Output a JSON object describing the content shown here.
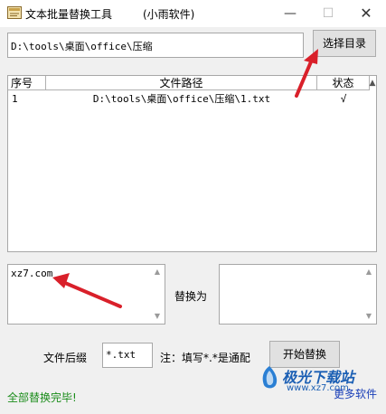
{
  "window": {
    "title": "文本批量替换工具",
    "subtitle": "(小雨软件)",
    "min_glyph": "—",
    "max_glyph": "☐",
    "close_glyph": "✕"
  },
  "folder": {
    "path_value": "D:\\tools\\桌面\\office\\压缩",
    "select_button": "选择目录"
  },
  "file_list": {
    "columns": [
      "序号",
      "文件路径",
      "状态"
    ],
    "sort_glyph": "▲",
    "rows": [
      {
        "seq": "1",
        "path": "D:\\tools\\桌面\\office\\压缩\\1.txt",
        "state": "√"
      }
    ]
  },
  "find": {
    "value": "xz7.com"
  },
  "replace": {
    "label": "替换为",
    "value": ""
  },
  "extension": {
    "label": "文件后缀",
    "value": "*.txt",
    "hint": "注：填写*.*是通配"
  },
  "actions": {
    "start_button": "开始替换"
  },
  "status": {
    "text": "全部替换完毕!"
  },
  "footer": {
    "more_link": "更多软件"
  },
  "watermark": {
    "brand": "极光下载站",
    "url": "www.xz7.com"
  },
  "colors": {
    "status_green": "#1a8c1a",
    "link_blue": "#1a3fb8",
    "arrow_red": "#d9202a"
  },
  "icons": {
    "app": "app-book-icon",
    "scroll_up": "scroll-up-icon",
    "scroll_down": "scroll-down-icon"
  }
}
